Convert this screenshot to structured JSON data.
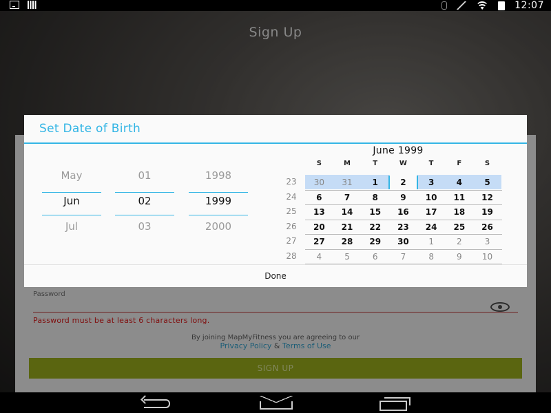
{
  "status_bar": {
    "time": "12:07",
    "left_icons": [
      "download-icon",
      "signal-bars-icon"
    ],
    "right_icons": [
      "bluetooth-icon",
      "mute-icon",
      "wifi-icon",
      "battery-icon"
    ]
  },
  "app": {
    "title": "Sign Up",
    "password": {
      "label": "Password",
      "error": "Password must be at least 6 characters long."
    },
    "terms_text": "By joining MapMyFitness you are agreeing to our",
    "privacy_link": "Privacy Policy",
    "amp": "&",
    "terms_link": "Terms of Use",
    "signup_button": "SIGN UP",
    "colors": {
      "accent": "#33b5e5",
      "button": "#8a9b1a",
      "error": "#c41616"
    }
  },
  "dialog": {
    "title": "Set Date of Birth",
    "spinners": {
      "month": {
        "prev": "May",
        "selected": "Jun",
        "next": "Jul"
      },
      "day": {
        "prev": "01",
        "selected": "02",
        "next": "03"
      },
      "year": {
        "prev": "1998",
        "selected": "1999",
        "next": "2000"
      }
    },
    "calendar": {
      "month_title": "June 1999",
      "weekdays": [
        "S",
        "M",
        "T",
        "W",
        "T",
        "F",
        "S"
      ],
      "weeks": [
        {
          "num": "23",
          "days": [
            "30",
            "31",
            "1",
            "2",
            "3",
            "4",
            "5"
          ],
          "in_month": [
            false,
            false,
            true,
            true,
            true,
            true,
            true
          ]
        },
        {
          "num": "24",
          "days": [
            "6",
            "7",
            "8",
            "9",
            "10",
            "11",
            "12"
          ],
          "in_month": [
            true,
            true,
            true,
            true,
            true,
            true,
            true
          ]
        },
        {
          "num": "25",
          "days": [
            "13",
            "14",
            "15",
            "16",
            "17",
            "18",
            "19"
          ],
          "in_month": [
            true,
            true,
            true,
            true,
            true,
            true,
            true
          ]
        },
        {
          "num": "26",
          "days": [
            "20",
            "21",
            "22",
            "23",
            "24",
            "25",
            "26"
          ],
          "in_month": [
            true,
            true,
            true,
            true,
            true,
            true,
            true
          ]
        },
        {
          "num": "27",
          "days": [
            "27",
            "28",
            "29",
            "30",
            "1",
            "2",
            "3"
          ],
          "in_month": [
            true,
            true,
            true,
            true,
            false,
            false,
            false
          ]
        },
        {
          "num": "28",
          "days": [
            "4",
            "5",
            "6",
            "7",
            "8",
            "9",
            "10"
          ],
          "in_month": [
            false,
            false,
            false,
            false,
            false,
            false,
            false
          ]
        }
      ],
      "selected_day": "2"
    },
    "done_label": "Done"
  },
  "nav_bar": {
    "buttons": [
      "back-icon",
      "home-icon",
      "recent-apps-icon"
    ]
  }
}
